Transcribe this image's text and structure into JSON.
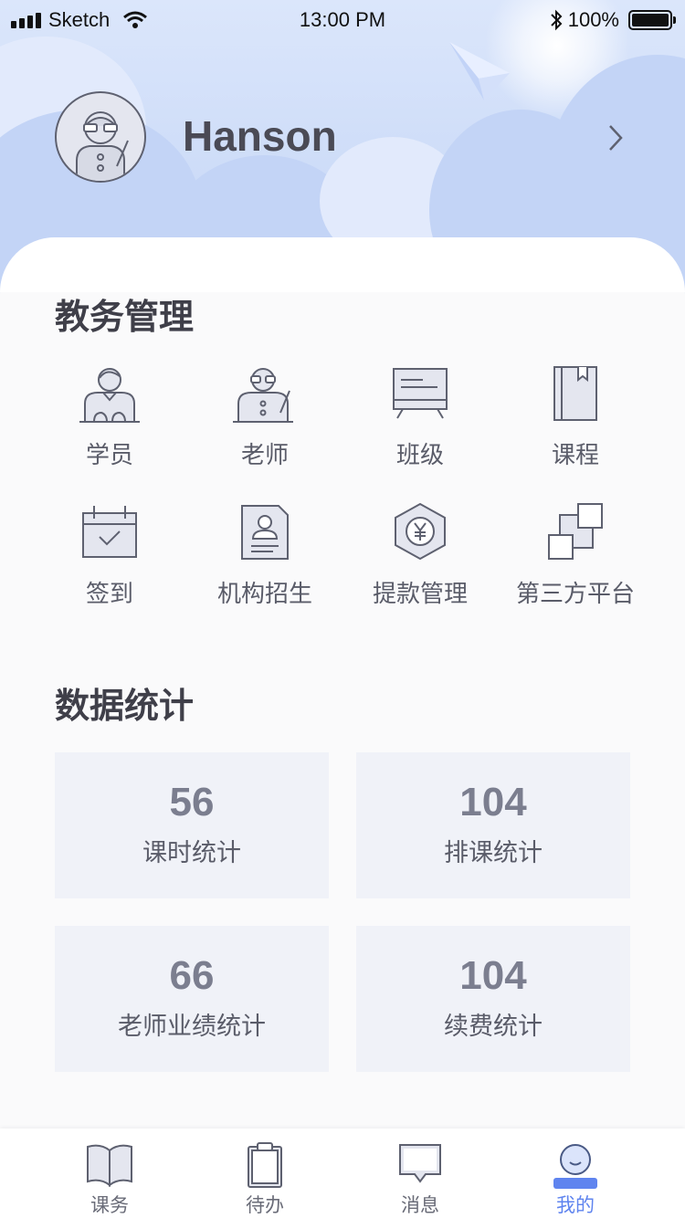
{
  "status_bar": {
    "carrier": "Sketch",
    "time": "13:00 PM",
    "battery": "100%"
  },
  "profile": {
    "name": "Hanson"
  },
  "academic": {
    "title": "教务管理",
    "items": [
      {
        "label": "学员",
        "icon": "student-icon"
      },
      {
        "label": "老师",
        "icon": "teacher-icon"
      },
      {
        "label": "班级",
        "icon": "classroom-board-icon"
      },
      {
        "label": "课程",
        "icon": "course-book-icon"
      },
      {
        "label": "签到",
        "icon": "calendar-check-icon"
      },
      {
        "label": "机构招生",
        "icon": "enrollment-document-icon"
      },
      {
        "label": "提款管理",
        "icon": "yuan-hexagon-icon"
      },
      {
        "label": "第三方平台",
        "icon": "third-party-squares-icon"
      }
    ]
  },
  "stats": {
    "title": "数据统计",
    "cards": [
      {
        "value": "56",
        "label": "课时统计"
      },
      {
        "value": "104",
        "label": "排课统计"
      },
      {
        "value": "66",
        "label": "老师业绩统计"
      },
      {
        "value": "104",
        "label": "续费统计"
      }
    ]
  },
  "tabbar": {
    "tabs": [
      {
        "label": "课务",
        "icon": "open-book-icon"
      },
      {
        "label": "待办",
        "icon": "clipboard-icon"
      },
      {
        "label": "消息",
        "icon": "chat-bubble-icon"
      },
      {
        "label": "我的",
        "icon": "profile-icon"
      }
    ],
    "active": "我的",
    "active_color": "#5f84ef"
  },
  "colors": {
    "header_bg": "#cddcf8",
    "accent": "#5f84ef",
    "card_bg": "#f0f2f8"
  }
}
